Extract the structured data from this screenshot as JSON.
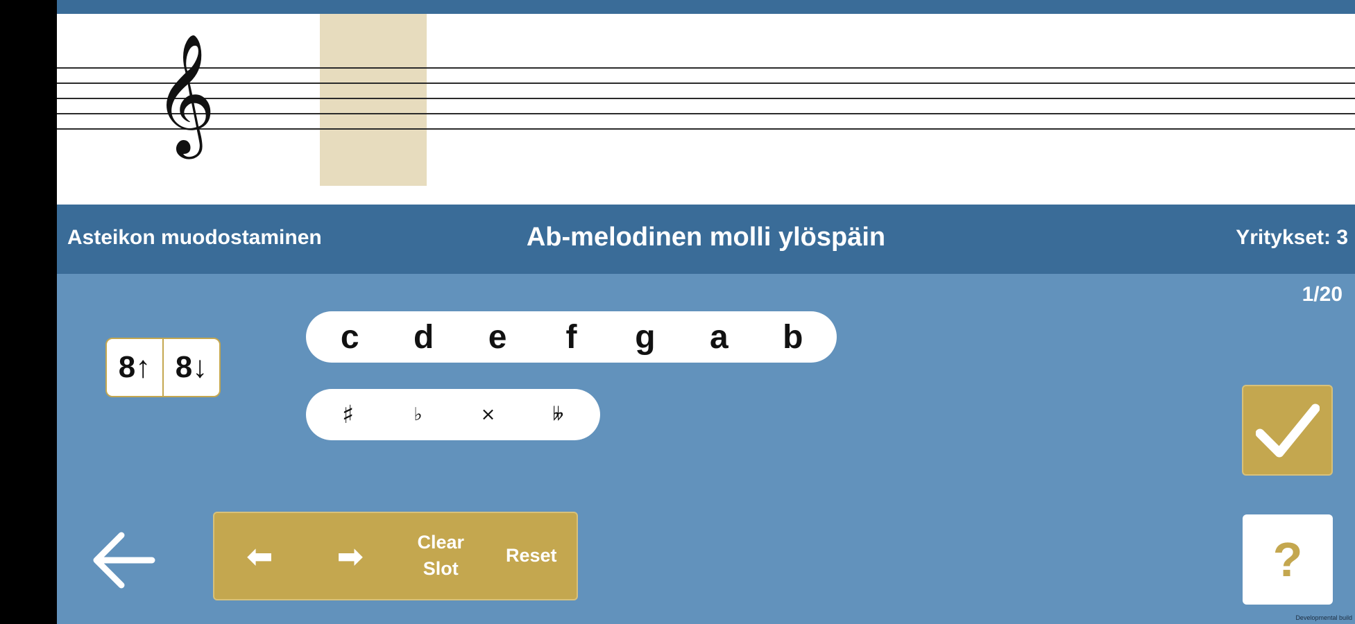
{
  "header": {
    "exercise_type": "Asteikon muodostaminen",
    "task_title": "Ab-melodinen molli ylöspäin",
    "attempts": "Yritykset: 3"
  },
  "progress": "1/20",
  "octave_buttons": [
    {
      "label": "8↑"
    },
    {
      "label": "8↓"
    }
  ],
  "note_buttons": [
    "c",
    "d",
    "e",
    "f",
    "g",
    "a",
    "b"
  ],
  "accidental_buttons": [
    "♯",
    "♭",
    "×",
    "𝄫"
  ],
  "toolbar": {
    "move_left": "⬅",
    "move_right": "➡",
    "clear_slot": "Clear\nSlot",
    "reset": "Reset"
  },
  "help_label": "?",
  "footer_note": "Developmental build",
  "colors": {
    "accent_gold": "#c4a74f",
    "title_bar": "#3a6c98",
    "panel_blue": "#6292bc",
    "highlight_slot": "#e7dcbe"
  },
  "icons": {
    "clef": "treble-clef-icon",
    "check": "check-icon",
    "back": "back-arrow-icon"
  }
}
